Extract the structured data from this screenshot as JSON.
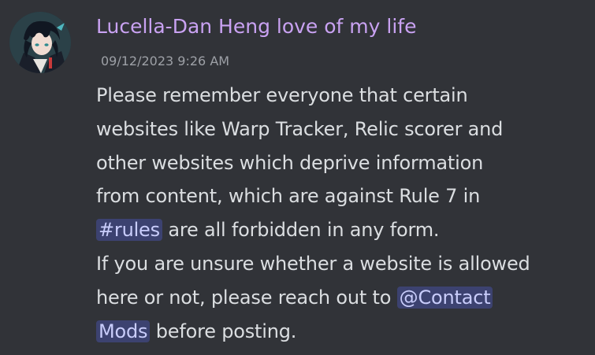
{
  "message": {
    "author": {
      "name": "Lucella-Dan Heng love of my life",
      "name_color": "#c9a2f2",
      "avatar_icon": "anime-character-avatar"
    },
    "timestamp": "09/12/2023 9:26 AM",
    "content": {
      "line1": "Please remember everyone that certain",
      "line2": "websites like Warp Tracker, Relic scorer and",
      "line3": "other websites which deprive information",
      "line4": "from content, which are against Rule 7 in",
      "line5_after_channel": " are all forbidden in any form.",
      "line6": "If you are unsure whether a website is allowed",
      "line7_before_mention": "here or not, please reach out to ",
      "line8_after_mention": " before posting."
    },
    "channel_mention": "#rules",
    "role_mention_part1": "@Contact",
    "role_mention_part2": "Mods",
    "colors": {
      "background": "#313338",
      "text": "#dbdee1",
      "mention_bg": "#3c4270",
      "mention_text": "#c9cdfb",
      "timestamp": "#9da0a6"
    }
  }
}
